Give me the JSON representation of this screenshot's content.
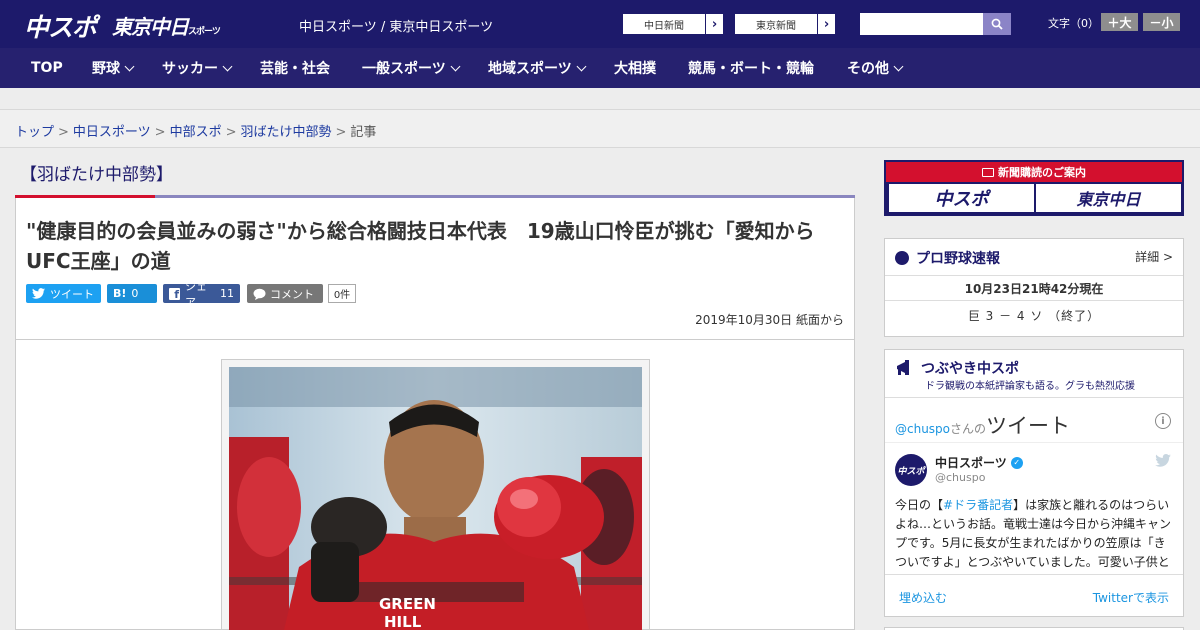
{
  "header": {
    "logo_chuspo": "中スポ",
    "logo_tokyo": "東京中日",
    "logo_tokyo_small": "スポーツ",
    "site_title": "中日スポーツ / 東京中日スポーツ",
    "btn_chunichi": "中日新聞",
    "btn_tokyo": "東京新聞",
    "font_label": "文字（0）",
    "font_plus": "＋大",
    "font_minus": "－小",
    "search_placeholder": ""
  },
  "nav": {
    "items": [
      {
        "label": "TOP"
      },
      {
        "label": "野球"
      },
      {
        "label": "サッカー"
      },
      {
        "label": "芸能・社会"
      },
      {
        "label": "一般スポーツ"
      },
      {
        "label": "地域スポーツ"
      },
      {
        "label": "大相撲"
      },
      {
        "label": "競馬・ボート・競輪"
      },
      {
        "label": "その他"
      }
    ]
  },
  "breadcrumb": {
    "items": [
      "トップ",
      "中日スポーツ",
      "中部スポ",
      "羽ばたけ中部勢"
    ],
    "current": "記事",
    "sep": ">"
  },
  "article": {
    "category": "【羽ばたけ中部勢】",
    "headline": "\"健康目的の会員並みの弱さ\"から総合格闘技日本代表　19歳山口怜臣が挑む「愛知からUFC王座」の道",
    "share_tweet": "ツイート",
    "share_hatena_icon": "B!",
    "share_hatena_count": "0",
    "share_fb": "シェア",
    "share_fb_count": "11",
    "share_comment": "コメント",
    "comment_count": "0件",
    "dateline": "2019年10月30日 紙面から"
  },
  "sidebar": {
    "ad_title": "新聞購読のご案内",
    "ad_chuspo": "中スポ",
    "ad_tokyo": "東京中日",
    "baseball_title": "プロ野球速報",
    "baseball_detail": "詳細 >",
    "baseball_time": "10月23日21時42分現在",
    "baseball_score": "巨 3 － 4 ソ （終了）",
    "tweets_title": "つぶやき中スポ",
    "tweets_sub": "ドラ観戦の本紙評論家も語る。グラも熱烈応援",
    "tw_handle": "@chuspo",
    "tw_san": "さんの",
    "tw_tweet": "ツイート",
    "tw_name": "中日スポーツ",
    "tw_user": "@chuspo",
    "tw_avatar": "中スポ",
    "tw_text_1": "今日の【",
    "tw_text_tag": "#ドラ番記者",
    "tw_text_2": "】は家族と離れるのはつらいよね…というお話。竜戦士達は今日から沖縄キャンプです。5月に長女が生まれたばかりの笠原は「きついですよ」とつぶやいていました。可愛い子供と",
    "tw_embed": "埋め込む",
    "tw_view": "Twitterで表示"
  },
  "colors": {
    "header_bg": "#1d1a6b",
    "nav_bg": "#26216f",
    "accent_red": "#d3102e",
    "twitter_blue": "#1da1f2",
    "facebook_blue": "#3b5998"
  }
}
